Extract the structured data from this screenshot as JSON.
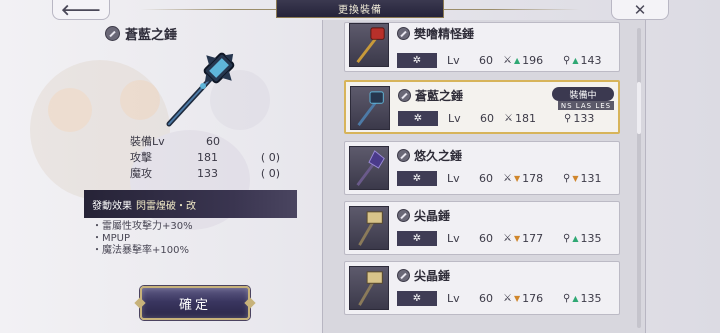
{
  "header": {
    "title": "更換裝備",
    "back_icon": "back-arrow-icon",
    "close_icon": "close-icon"
  },
  "detail": {
    "name": "蒼藍之錘",
    "stats": {
      "level_label": "裝備Lv",
      "level_value": "60",
      "attack_label": "攻擊",
      "attack_value": "181",
      "attack_bonus": "(      0)",
      "magic_label": "魔攻",
      "magic_value": "133",
      "magic_bonus": "(      0)"
    },
    "effect": {
      "label": "發動效果",
      "name": "閃雷煌破・改"
    },
    "effect_list": [
      "・雷屬性攻擊力+30%",
      "・MPUP",
      "・魔法暴擊率+100%"
    ],
    "confirm_label": "確定"
  },
  "list": {
    "lv_label": "Lv",
    "star_label": "✲",
    "equipped_label": "裝備中",
    "equipped_sub": "NS  LAS  LES",
    "items": [
      {
        "name": "樊噲精怪錘",
        "level": "60",
        "attack": "196",
        "attack_trend": "up",
        "magic": "143",
        "magic_trend": "up",
        "thumb": "red-mace"
      },
      {
        "name": "蒼藍之錘",
        "level": "60",
        "attack": "181",
        "attack_trend": "none",
        "magic": "133",
        "magic_trend": "none",
        "thumb": "blue-mace",
        "equipped": true
      },
      {
        "name": "悠久之錘",
        "level": "60",
        "attack": "178",
        "attack_trend": "down",
        "magic": "131",
        "magic_trend": "down",
        "thumb": "purple-mace"
      },
      {
        "name": "尖晶錘",
        "level": "60",
        "attack": "177",
        "attack_trend": "down",
        "magic": "135",
        "magic_trend": "up",
        "thumb": "gold-hammer"
      },
      {
        "name": "尖晶錘",
        "level": "60",
        "attack": "176",
        "attack_trend": "down",
        "magic": "135",
        "magic_trend": "up",
        "thumb": "gold-hammer"
      }
    ]
  },
  "colors": {
    "accent_gold": "#d7b45a",
    "stat_up": "#2fa874",
    "stat_down": "#d0862c",
    "panel_dark": "#3f3c55"
  }
}
